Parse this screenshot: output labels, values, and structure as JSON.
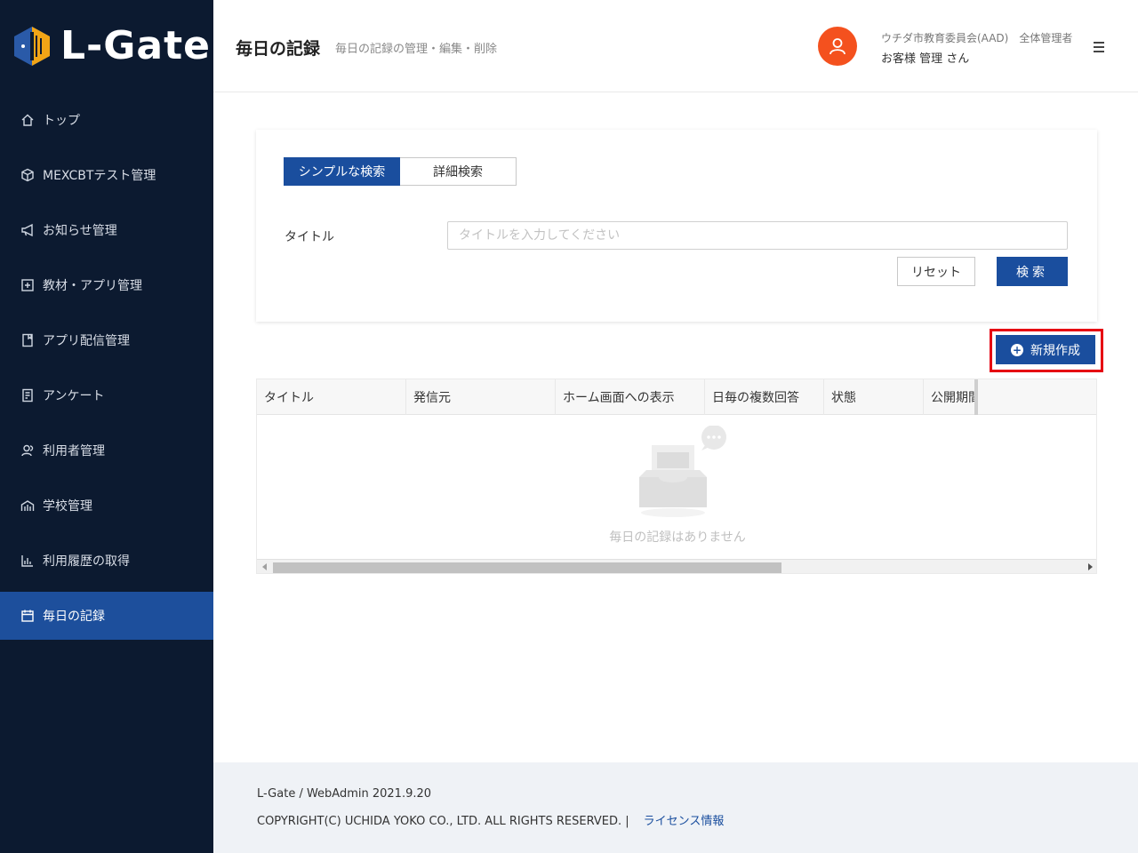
{
  "app": {
    "logo_text": "L-Gate"
  },
  "sidebar": {
    "items": [
      {
        "label": "トップ",
        "icon": "home-icon"
      },
      {
        "label": "MEXCBTテスト管理",
        "icon": "cube-icon"
      },
      {
        "label": "お知らせ管理",
        "icon": "megaphone-icon"
      },
      {
        "label": "教材・アプリ管理",
        "icon": "plus-square-icon"
      },
      {
        "label": "アプリ配信管理",
        "icon": "bookmark-icon"
      },
      {
        "label": "アンケート",
        "icon": "survey-icon"
      },
      {
        "label": "利用者管理",
        "icon": "users-icon"
      },
      {
        "label": "学校管理",
        "icon": "school-icon"
      },
      {
        "label": "利用履歴の取得",
        "icon": "bar-chart-icon"
      },
      {
        "label": "毎日の記録",
        "icon": "calendar-icon",
        "active": true
      }
    ]
  },
  "header": {
    "title": "毎日の記録",
    "subtitle": "毎日の記録の管理・編集・削除",
    "user_org": "ウチダ市教育委員会(AAD)　全体管理者",
    "user_name": "お客様 管理 さん"
  },
  "search": {
    "tabs": [
      "シンプルな検索",
      "詳細検索"
    ],
    "active_tab": 0,
    "title_label": "タイトル",
    "title_placeholder": "タイトルを入力してください",
    "title_value": "",
    "reset_label": "リセット",
    "search_label": "検索"
  },
  "actions": {
    "new_label": "新規作成"
  },
  "table": {
    "columns": [
      "タイトル",
      "発信元",
      "ホーム画面への表示",
      "日毎の複数回答",
      "状態",
      "公開期間"
    ],
    "rows": [],
    "empty_text": "毎日の記録はありません"
  },
  "footer": {
    "version": "L-Gate / WebAdmin 2021.9.20",
    "copyright": "COPYRIGHT(C) UCHIDA YOKO CO., LTD. ALL RIGHTS RESERVED. |",
    "license_link": "ライセンス情報"
  },
  "colors": {
    "sidebar_bg": "#0c1a30",
    "primary": "#1a4e9e",
    "avatar": "#f4511e",
    "highlight": "#e60012"
  }
}
